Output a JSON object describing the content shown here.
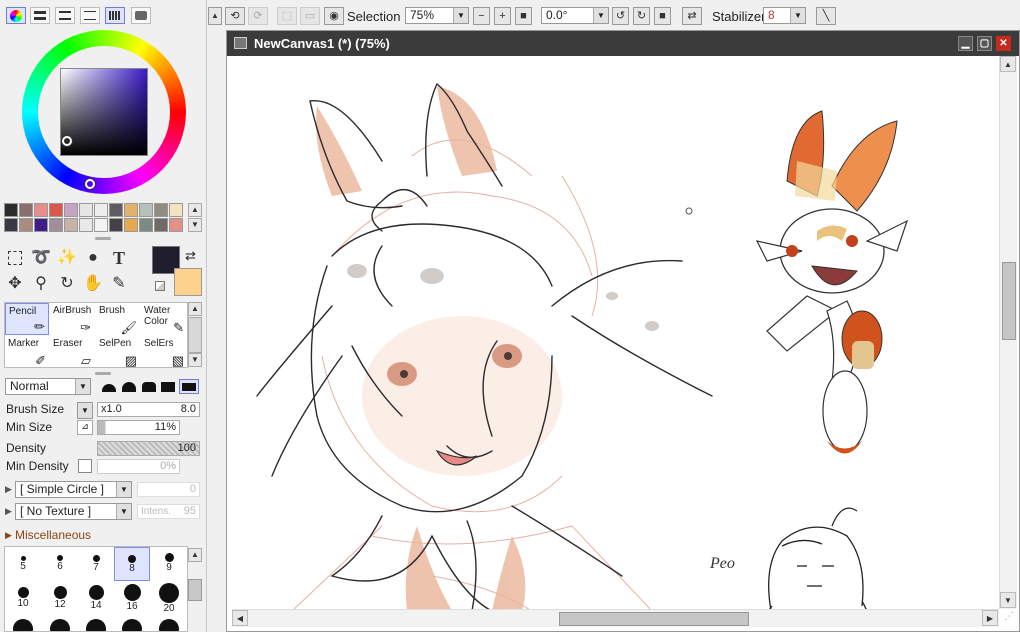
{
  "left_panel": {
    "blend_mode": "Normal",
    "brush_size_label": "Brush Size",
    "brush_size_multiplier": "x1.0",
    "brush_size_value": "8.0",
    "min_size_label": "Min Size",
    "min_size_value": "11%",
    "density_label": "Density",
    "density_value": "100",
    "min_density_label": "Min Density",
    "min_density_value": "0%",
    "shape_dropdown": "[ Simple Circle ]",
    "shape_value": "0",
    "texture_dropdown": "[ No Texture ]",
    "texture_intensity_label": "Intens.",
    "texture_intensity_value": "95",
    "misc_label": "Miscellaneous",
    "brushes": [
      {
        "label": "Pencil"
      },
      {
        "label": "AirBrush"
      },
      {
        "label": "Brush"
      },
      {
        "label": "Water Color"
      },
      {
        "label": "Marker"
      },
      {
        "label": "Eraser"
      },
      {
        "label": "SelPen"
      },
      {
        "label": "SelErs"
      }
    ],
    "brush_sizes": [
      "5",
      "6",
      "7",
      "8",
      "9",
      "10",
      "12",
      "14",
      "16",
      "20"
    ],
    "selected_brush_size": "8",
    "primary_color": "#1f1d2b",
    "secondary_color": "#fdd28c"
  },
  "toolbar": {
    "selection_label": "Selection",
    "zoom_value": "75%",
    "rotation_value": "0.0°",
    "stabilizer_label": "Stabilizer",
    "stabilizer_value": "8"
  },
  "canvas_window": {
    "title": "NewCanvas1 (*) (75%)",
    "doodle_text": "Peo"
  }
}
